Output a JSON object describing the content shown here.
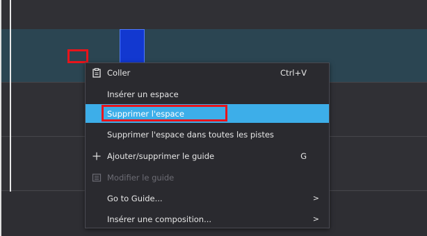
{
  "menu": {
    "items": [
      {
        "label": "Coller",
        "shortcut": "Ctrl+V",
        "icon": "paste-icon"
      },
      {
        "label": "Insérer un espace"
      },
      {
        "label": "Supprimer l'espace",
        "highlighted": true
      },
      {
        "label": "Supprimer l'espace dans toutes les pistes"
      },
      {
        "label": "Ajouter/supprimer le guide",
        "shortcut": "G",
        "icon": "plus-icon"
      },
      {
        "label": "Modifier le guide",
        "disabled": true,
        "icon": "edit-guide-icon"
      },
      {
        "label": "Go to Guide...",
        "submenu": true
      },
      {
        "label": "Insérer une composition...",
        "submenu": true
      }
    ],
    "submenu_arrow": ">"
  },
  "colors": {
    "highlight": "#3daee9",
    "annotation_red": "#e8141b",
    "clip": "#1238d0"
  }
}
